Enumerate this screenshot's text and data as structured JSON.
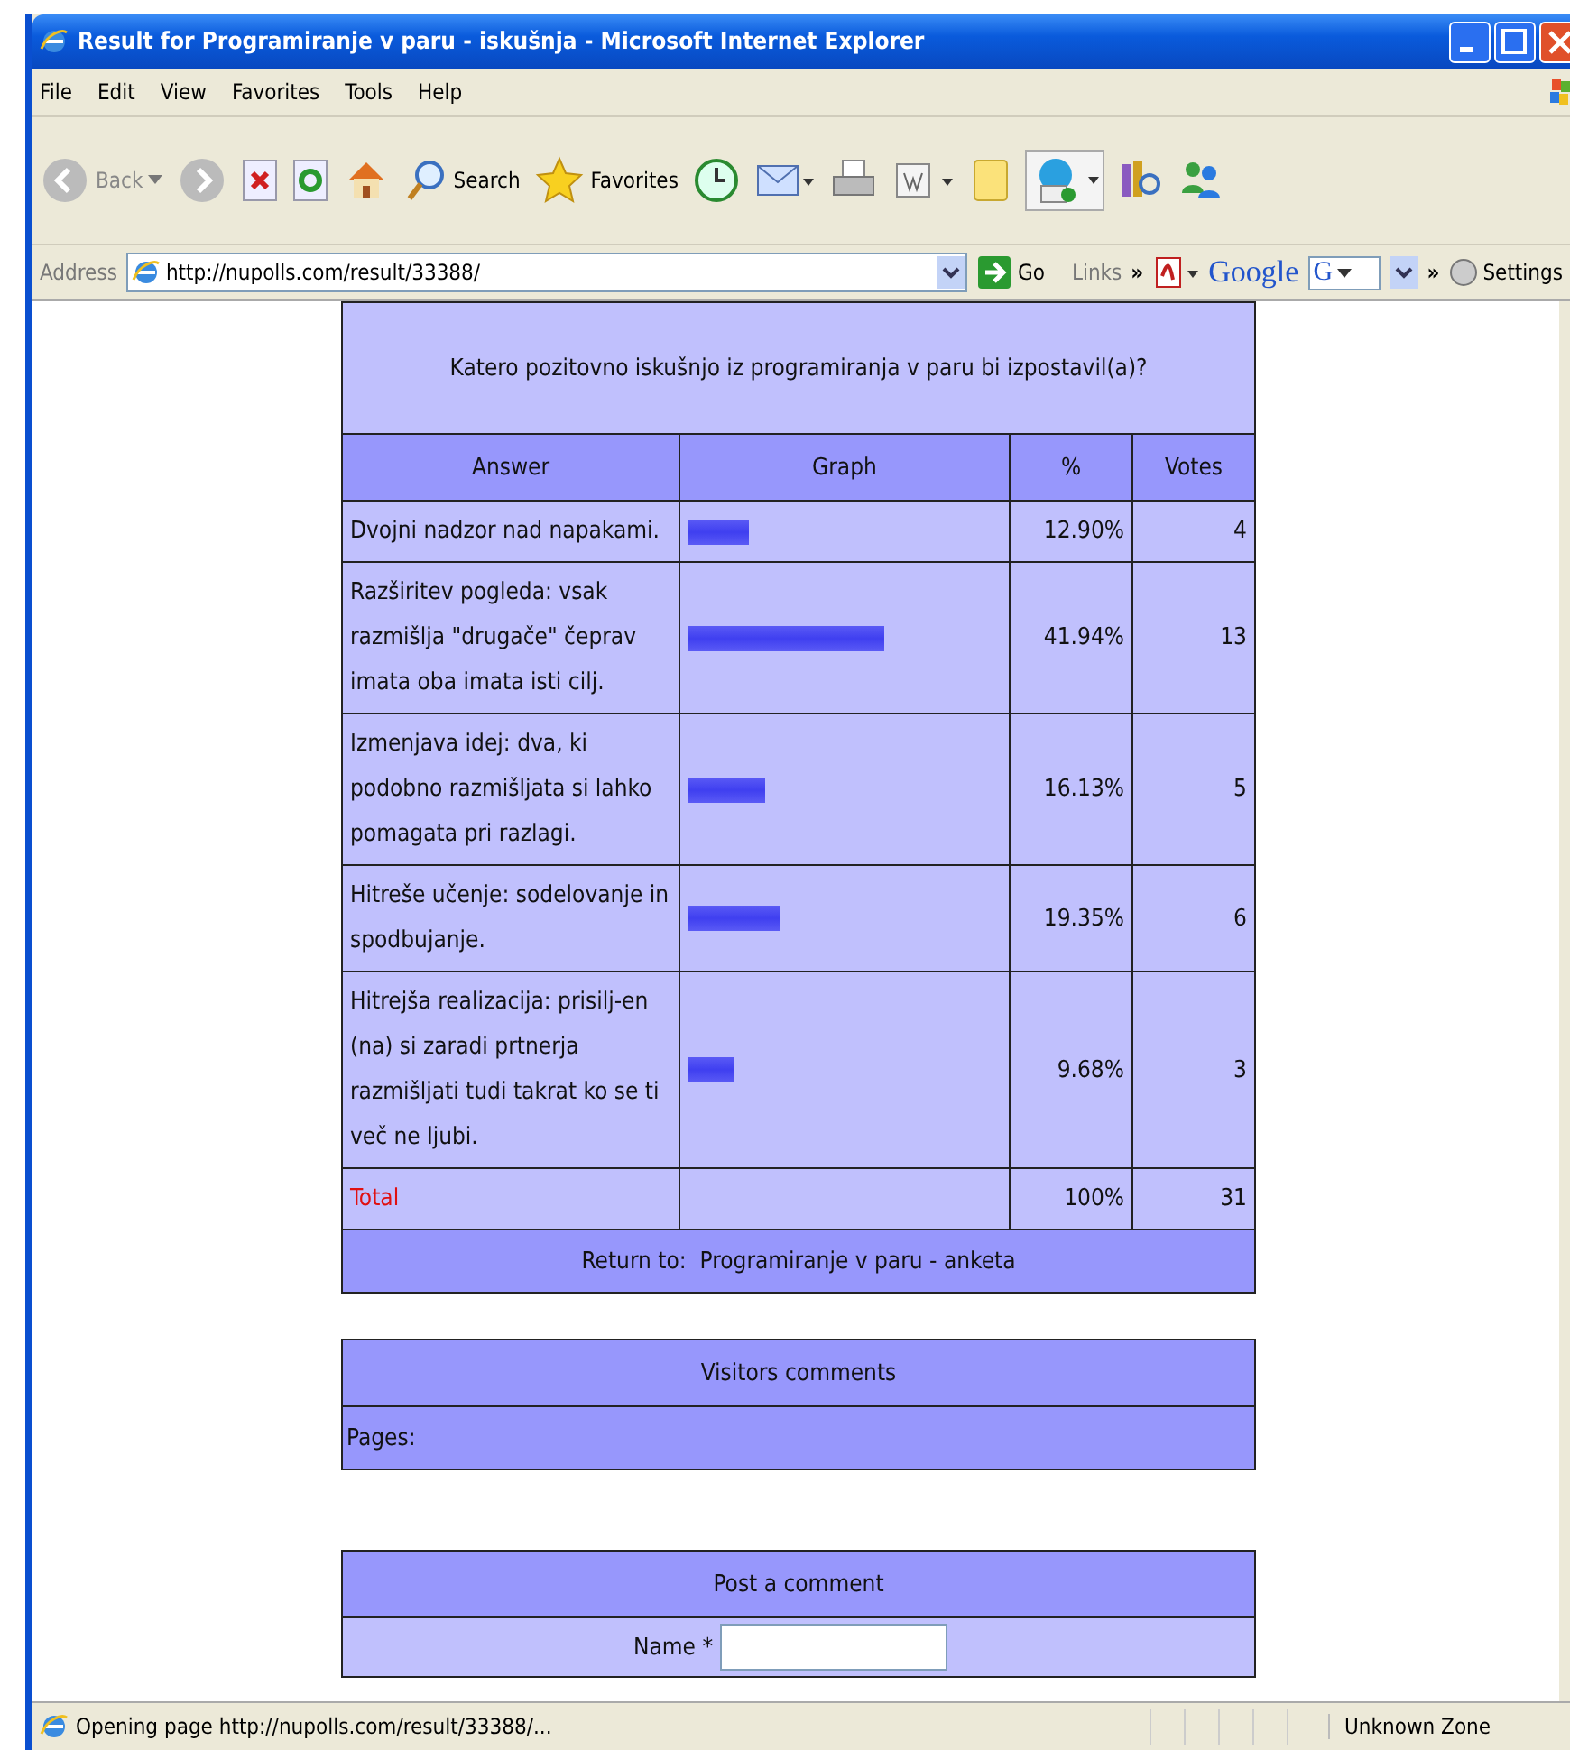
{
  "window": {
    "title": "Result for Programiranje v paru - iskušnja - Microsoft Internet Explorer"
  },
  "menu": [
    "File",
    "Edit",
    "View",
    "Favorites",
    "Tools",
    "Help"
  ],
  "toolbar": {
    "back": "Back",
    "search": "Search",
    "favorites": "Favorites"
  },
  "address_bar": {
    "label": "Address",
    "url": "http://nupolls.com/result/33388/",
    "go": "Go",
    "links": "Links",
    "chevron": "»",
    "google": "Google",
    "google_box": "G",
    "chevron2": "»",
    "settings": "Settings"
  },
  "poll": {
    "question": "Katero pozitovno iskušnjo iz programiranja v paru bi izpostavil(a)?",
    "columns": [
      "Answer",
      "Graph",
      "%",
      "Votes"
    ],
    "rows": [
      {
        "answer": "Dvojni nadzor nad napakami.",
        "level": 0.2,
        "percent": "12.90%",
        "votes": "4"
      },
      {
        "answer": "Razširitev pogleda: vsak razmišlja \"drugače\" čeprav imata oba imata isti cilj.",
        "level": 0.64,
        "percent": "41.94%",
        "votes": "13"
      },
      {
        "answer": "Izmenjava idej: dva, ki podobno razmišljata si lahko pomagata pri razlagi.",
        "level": 0.25,
        "percent": "16.13%",
        "votes": "5"
      },
      {
        "answer": "Hitreše učenje: sodelovanje in spodbujanje.",
        "level": 0.3,
        "percent": "19.35%",
        "votes": "6"
      },
      {
        "answer": "Hitrejša realizacija: prisilj-en (na) si zaradi prtnerja razmišljati tudi takrat ko se ti več ne ljubi.",
        "level": 0.15,
        "percent": "9.68%",
        "votes": "3"
      }
    ],
    "total": {
      "label": "Total",
      "percent": "100%",
      "votes": "31"
    },
    "return_label": "Return to:",
    "return_link": "Programiranje v paru - anketa"
  },
  "comments": {
    "title": "Visitors comments",
    "pages": "Pages:"
  },
  "post": {
    "title": "Post a comment",
    "name_label": "Name *"
  },
  "status_bar": {
    "text": "Opening page http://nupolls.com/result/33388/...",
    "zone": "Unknown Zone"
  }
}
